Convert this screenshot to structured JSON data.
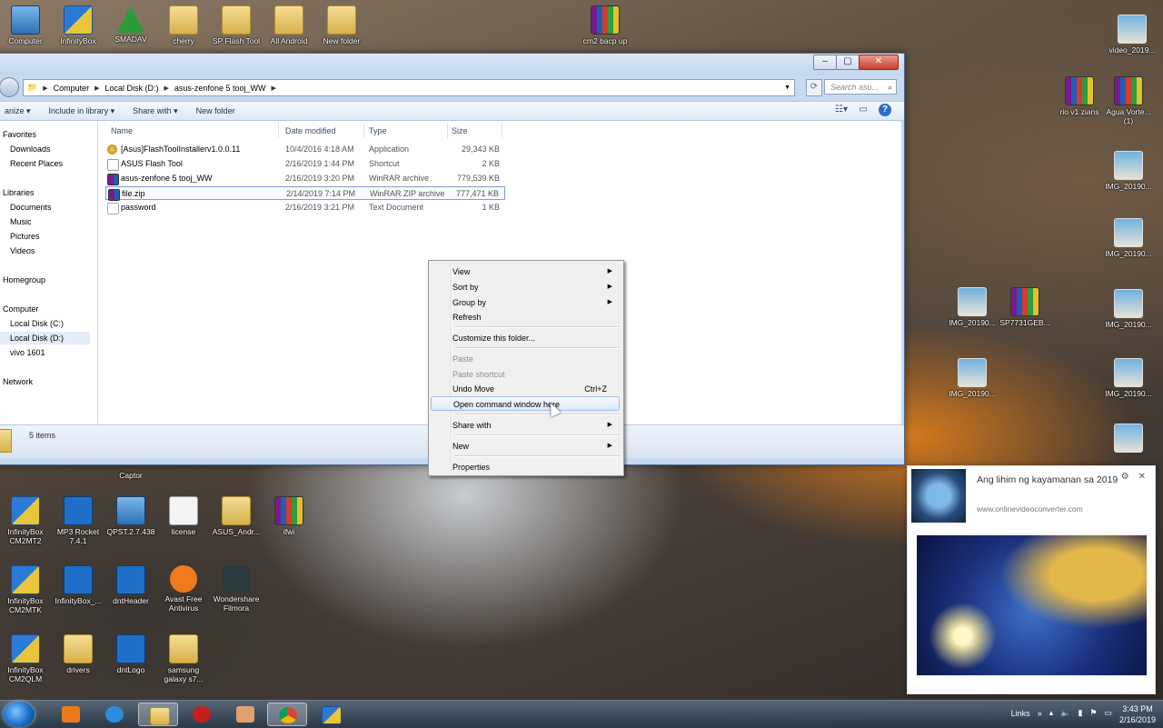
{
  "desktop": {
    "top_icons": [
      "Computer",
      "InfinityBox",
      "SMADAV",
      "cherry",
      "SP Flash Tool",
      "All Android",
      "New folder",
      "cm2 bacp up",
      "video_2019..."
    ],
    "right_icons": [
      "rio v1 zians",
      "Agua Vorte... (1)",
      "IMG_20190...",
      "IMG_20190...",
      "IMG_20190...",
      "SP7731GEB...",
      "IMG_20190...",
      "IMG_20190...",
      "IMG_20190..."
    ],
    "bottom_icons": [
      "InfinityBox CM2MT2",
      "MP3 Rocket 7.4.1",
      "QPST.2.7.438",
      "license",
      "ASUS_Andr...",
      "ifwi",
      "InfinityBox CM2MTK",
      "InfinityBox_...",
      "dntHeader",
      "Avast Free Antivirus",
      "Wondershare Filmora",
      "InfinityBox CM2QLM",
      "drivers",
      "dntLogo",
      "samsung galaxy s7..."
    ],
    "partial_label": "Captor"
  },
  "explorer": {
    "breadcrumb": [
      "Computer",
      "Local Disk (D:)",
      "asus-zenfone 5 tooj_WW"
    ],
    "search_placeholder": "Search asu...",
    "toolbar": [
      "anize",
      "Include in library",
      "Share with",
      "New folder"
    ],
    "columns": {
      "name": "Name",
      "date": "Date modified",
      "type": "Type",
      "size": "Size"
    },
    "files": [
      {
        "name": "[Asus]FlashToolInstallerv1.0.0.11",
        "date": "10/4/2016 4:18 AM",
        "type": "Application",
        "size": "29,343 KB",
        "icon": "app-icon"
      },
      {
        "name": "ASUS Flash Tool",
        "date": "2/16/2019 1:44 PM",
        "type": "Shortcut",
        "size": "2 KB",
        "icon": "shortcut-icon"
      },
      {
        "name": "asus-zenfone 5 tooj_WW",
        "date": "2/16/2019 3:20 PM",
        "type": "WinRAR archive",
        "size": "779,539 KB",
        "icon": "rar-icon"
      },
      {
        "name": "file.zip",
        "date": "2/14/2019 7:14 PM",
        "type": "WinRAR ZIP archive",
        "size": "777,471 KB",
        "icon": "zip-icon"
      },
      {
        "name": "password",
        "date": "2/16/2019 3:21 PM",
        "type": "Text Document",
        "size": "1 KB",
        "icon": "text-file-icon"
      }
    ],
    "nav": {
      "favorites": "Favorites",
      "downloads": "Downloads",
      "recent": "Recent Places",
      "libraries": "Libraries",
      "documents": "Documents",
      "music": "Music",
      "pictures": "Pictures",
      "videos": "Videos",
      "homegroup": "Homegroup",
      "computer": "Computer",
      "disk_c": "Local Disk (C:)",
      "disk_d": "Local Disk (D:)",
      "vivo": "vivo 1601",
      "network": "Network"
    },
    "status": "5 items"
  },
  "context_menu": {
    "view": "View",
    "sort_by": "Sort by",
    "group_by": "Group by",
    "refresh": "Refresh",
    "customize": "Customize this folder...",
    "paste": "Paste",
    "paste_shortcut": "Paste shortcut",
    "undo_move": "Undo Move",
    "undo_shortcut": "Ctrl+Z",
    "open_cmd": "Open command window here",
    "share_with": "Share with",
    "new": "New",
    "properties": "Properties"
  },
  "notification": {
    "title": "Ang lihim ng kayamanan sa 2019",
    "url": "www.onlinevideoconverter.com"
  },
  "taskbar": {
    "links": "Links",
    "time": "3:43 PM",
    "date": "2/16/2019"
  }
}
